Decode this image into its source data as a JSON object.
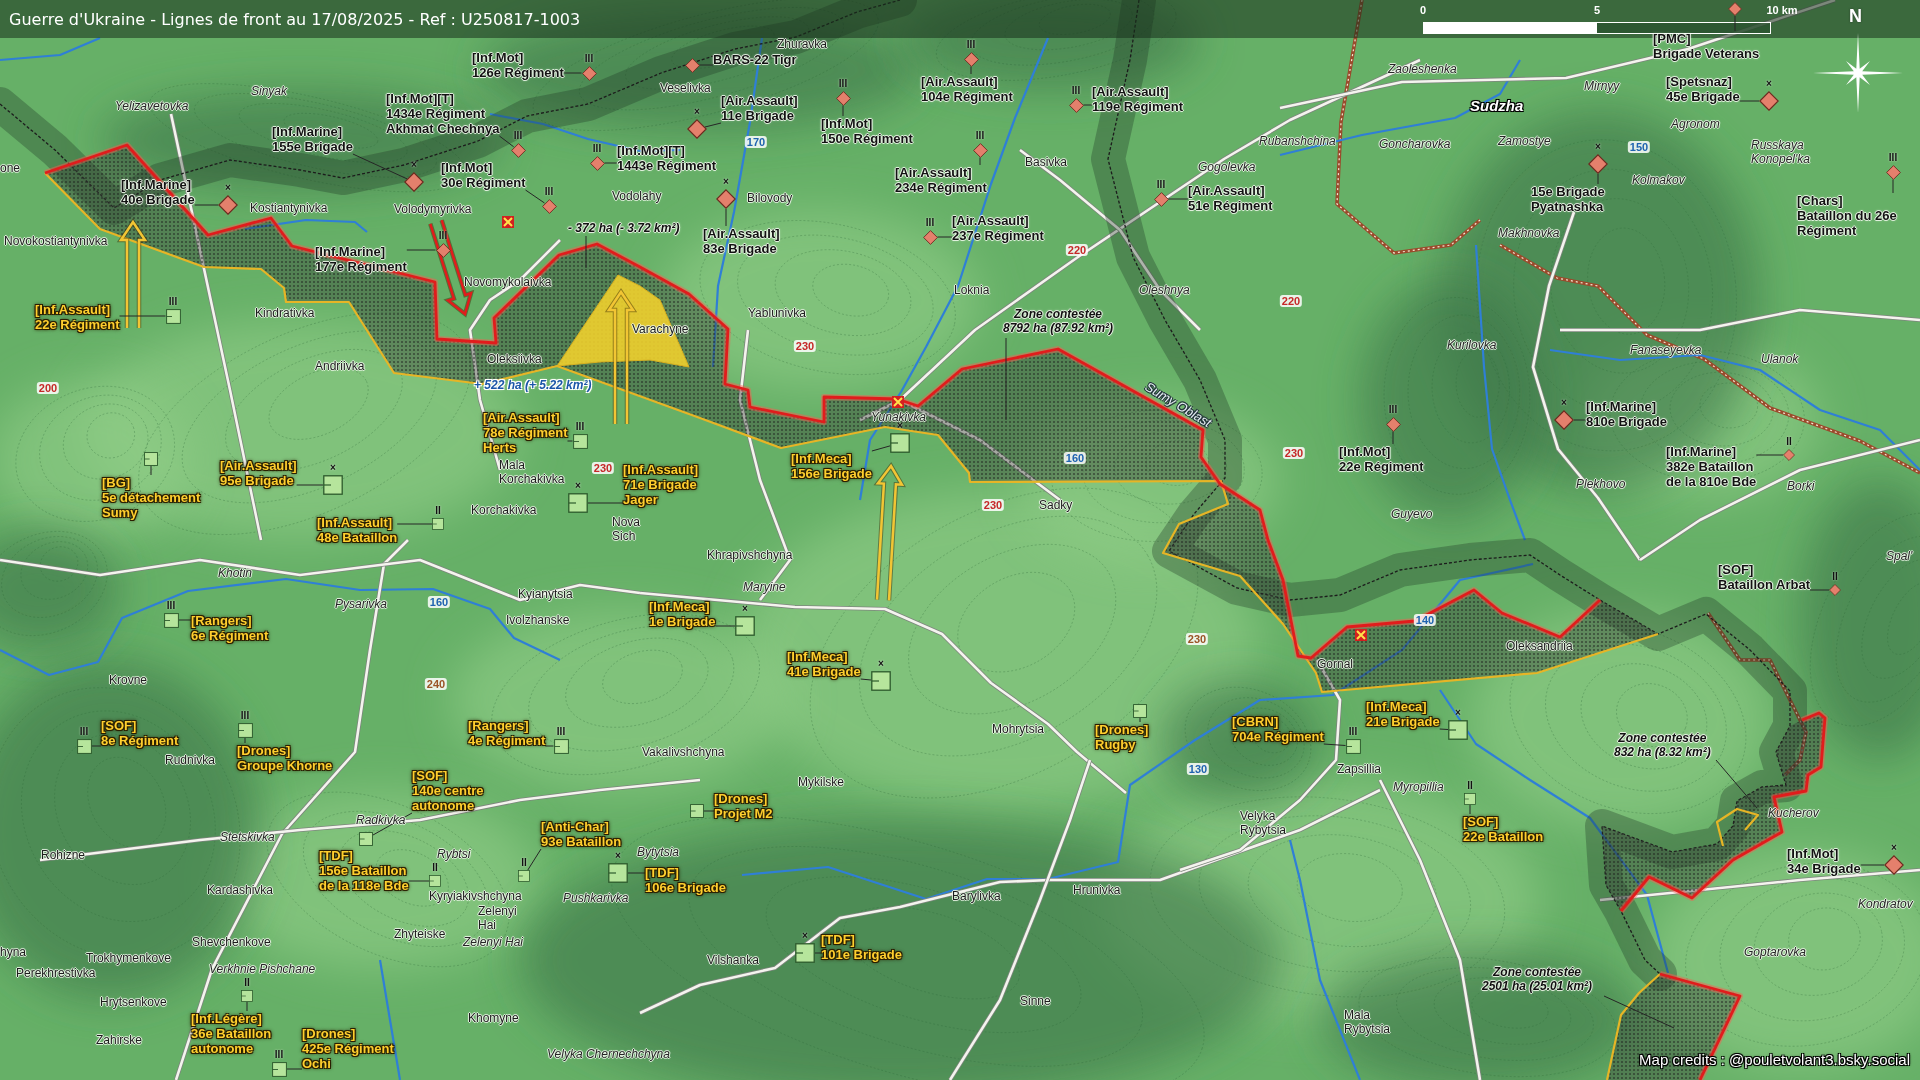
{
  "title": "Guerre d'Ukraine - Lignes de front au 17/08/2025 - Ref : U250817-1003",
  "scale_bar": {
    "ticks": [
      "0",
      "5",
      "10 km"
    ]
  },
  "compass": {
    "label": "N"
  },
  "units": [
    {
      "kind": "russian",
      "lines": [
        "[Inf.Mot]",
        "126e Régiment"
      ],
      "echelon": "III"
    },
    {
      "kind": "russian",
      "lines": [
        "BARS-22 Tigr"
      ]
    },
    {
      "kind": "russian",
      "lines": [
        "[Air.Assault]",
        "104e Régiment"
      ],
      "echelon": "III"
    },
    {
      "kind": "russian",
      "lines": [
        "[PMC]",
        "Brigade Veterans"
      ]
    },
    {
      "kind": "russian",
      "lines": [
        "[Inf.Mot][T]",
        "1434e Régiment",
        "Akhmat Chechnya"
      ],
      "echelon": "III"
    },
    {
      "kind": "russian",
      "lines": [
        "[Air.Assault]",
        "11e Brigade"
      ],
      "echelon": "×"
    },
    {
      "kind": "russian",
      "lines": [
        "[Inf.Mot]",
        "150e Régiment"
      ],
      "echelon": "III"
    },
    {
      "kind": "russian",
      "lines": [
        "[Air.Assault]",
        "119e Régiment"
      ],
      "echelon": "III"
    },
    {
      "kind": "russian",
      "lines": [
        "[Spetsnaz]",
        "45e Brigade"
      ],
      "echelon": "×"
    },
    {
      "kind": "russian",
      "lines": [
        "[Inf.Marine]",
        "40e Brigade"
      ],
      "echelon": "×"
    },
    {
      "kind": "russian",
      "lines": [
        "[Inf.Marine]",
        "155e Brigade"
      ],
      "echelon": "×"
    },
    {
      "kind": "russian",
      "lines": [
        "[Inf.Marine]",
        "177e Régiment"
      ],
      "echelon": "III"
    },
    {
      "kind": "russian",
      "lines": [
        "[Inf.Mot]",
        "30e Régiment"
      ],
      "echelon": "III"
    },
    {
      "kind": "russian",
      "lines": [
        "[Inf.Mot][T]",
        "1443e Régiment"
      ],
      "echelon": "III"
    },
    {
      "kind": "russian",
      "lines": [
        "[Air.Assault]",
        "83e Brigade"
      ],
      "echelon": "×"
    },
    {
      "kind": "russian",
      "lines": [
        "[Air.Assault]",
        "234e Régiment"
      ],
      "echelon": "III"
    },
    {
      "kind": "russian",
      "lines": [
        "[Air.Assault]",
        "237e Régiment"
      ],
      "echelon": "III"
    },
    {
      "kind": "russian",
      "lines": [
        "[Air.Assault]",
        "51e Régiment"
      ],
      "echelon": "III"
    },
    {
      "kind": "russian",
      "lines": [
        "15e Brigade",
        "Pyatnashka"
      ],
      "echelon": "×"
    },
    {
      "kind": "russian",
      "lines": [
        "[Chars]",
        "Bataillon du 26e",
        "Régiment"
      ],
      "echelon": "III"
    },
    {
      "kind": "ukrainian",
      "lines": [
        "[Inf.Assault]",
        "22e Régiment"
      ],
      "echelon": "III"
    },
    {
      "kind": "ukrainian",
      "lines": [
        "[Air.Assault]",
        "78e Régiment",
        "Herts"
      ],
      "echelon": "III"
    },
    {
      "kind": "ukrainian",
      "lines": [
        "[Inf.Meca]",
        "156e Brigade"
      ],
      "echelon": "×"
    },
    {
      "kind": "russian",
      "lines": [
        "[Inf.Mot]",
        "22e Régiment"
      ],
      "echelon": "III"
    },
    {
      "kind": "russian",
      "lines": [
        "[Inf.Marine]",
        "810e Brigade"
      ],
      "echelon": "×"
    },
    {
      "kind": "ukrainian",
      "lines": [
        "[BG]",
        "5e détachement",
        "Sumy"
      ]
    },
    {
      "kind": "ukrainian",
      "lines": [
        "[Air.Assault]",
        "95e Brigade"
      ],
      "echelon": "×"
    },
    {
      "kind": "ukrainian",
      "lines": [
        "[Inf.Assault]",
        "71e Brigade",
        "Jager"
      ],
      "echelon": "×"
    },
    {
      "kind": "russian",
      "lines": [
        "[Inf.Marine]",
        "382e Bataillon",
        "de la 810e Bde"
      ],
      "echelon": "II"
    },
    {
      "kind": "ukrainian",
      "lines": [
        "[Inf.Assault]",
        "48e Bataillon"
      ],
      "echelon": "II"
    },
    {
      "kind": "russian",
      "lines": [
        "[SOF]",
        "Bataillon Arbat"
      ],
      "echelon": "II"
    },
    {
      "kind": "ukrainian",
      "lines": [
        "[Rangers]",
        "6e Régiment"
      ],
      "echelon": "III"
    },
    {
      "kind": "ukrainian",
      "lines": [
        "[Inf.Meca]",
        "1e Brigade"
      ],
      "echelon": "×"
    },
    {
      "kind": "ukrainian",
      "lines": [
        "[Inf.Meca]",
        "41e Brigade"
      ],
      "echelon": "×"
    },
    {
      "kind": "ukrainian",
      "lines": [
        "[SOF]",
        "8e Régiment"
      ],
      "echelon": "III"
    },
    {
      "kind": "ukrainian",
      "lines": [
        "[Drones]",
        "Groupe Khorne"
      ],
      "echelon": "III"
    },
    {
      "kind": "ukrainian",
      "lines": [
        "[Rangers]",
        "4e Régiment"
      ],
      "echelon": "III"
    },
    {
      "kind": "ukrainian",
      "lines": [
        "[Drones]",
        "Rugby"
      ]
    },
    {
      "kind": "ukrainian",
      "lines": [
        "[CBRN]",
        "704e Régiment"
      ],
      "echelon": "III"
    },
    {
      "kind": "ukrainian",
      "lines": [
        "[Inf.Meca]",
        "21e Brigade"
      ],
      "echelon": "×"
    },
    {
      "kind": "ukrainian",
      "lines": [
        "[SOF]",
        "140e centre",
        "autonome"
      ]
    },
    {
      "kind": "ukrainian",
      "lines": [
        "[Drones]",
        "Projet M2"
      ]
    },
    {
      "kind": "ukrainian",
      "lines": [
        "[SOF]",
        "22e Bataillon"
      ],
      "echelon": "II"
    },
    {
      "kind": "ukrainian",
      "lines": [
        "[TDF]",
        "156e Bataillon",
        "de la 118e Bde"
      ],
      "echelon": "II"
    },
    {
      "kind": "ukrainian",
      "lines": [
        "[Anti-Char]",
        "93e Bataillon"
      ],
      "echelon": "II"
    },
    {
      "kind": "ukrainian",
      "lines": [
        "[TDF]",
        "106e Brigade"
      ],
      "echelon": "×"
    },
    {
      "kind": "russian",
      "lines": [
        "[Inf.Mot]",
        "34e Brigade"
      ],
      "echelon": "×"
    },
    {
      "kind": "ukrainian",
      "lines": [
        "[TDF]",
        "101e Brigade"
      ],
      "echelon": "×"
    },
    {
      "kind": "ukrainian",
      "lines": [
        "[Inf.Légère]",
        "36e Bataillon",
        "autonome"
      ],
      "echelon": "II"
    },
    {
      "kind": "ukrainian",
      "lines": [
        "[Drones]",
        "425e Régiment",
        "Ochi"
      ],
      "echelon": "III"
    }
  ],
  "places": [
    {
      "name": "Zhuravka",
      "kind": "village",
      "italic": false
    },
    {
      "name": "Zaoleshenka",
      "kind": "village",
      "italic": true
    },
    {
      "name": "Sinyak",
      "kind": "village",
      "italic": true
    },
    {
      "name": "Veselivka",
      "kind": "village",
      "italic": false
    },
    {
      "name": "Mirnyy",
      "kind": "village",
      "italic": true
    },
    {
      "name": "Yelizavetovka",
      "kind": "village",
      "italic": true
    },
    {
      "name": "Sudzha",
      "kind": "city",
      "italic": true
    },
    {
      "name": "Agronom",
      "kind": "village",
      "italic": true
    },
    {
      "name": "one",
      "kind": "village",
      "italic": false
    },
    {
      "name": "Basivka",
      "kind": "village",
      "italic": false
    },
    {
      "name": "Gogolevka",
      "kind": "village",
      "italic": true
    },
    {
      "name": "Rubanshchina",
      "kind": "village",
      "italic": true
    },
    {
      "name": "Goncharovka",
      "kind": "village",
      "italic": true
    },
    {
      "name": "Zamostye",
      "kind": "village",
      "italic": true
    },
    {
      "name": "Russkaya Konopel'ka",
      "kind": "village",
      "italic": true
    },
    {
      "name": "Kolmakov",
      "kind": "village",
      "italic": true
    },
    {
      "name": "Kostiantynivka",
      "kind": "village",
      "italic": false
    },
    {
      "name": "Volodymyrivka",
      "kind": "village",
      "italic": false
    },
    {
      "name": "Vodolahy",
      "kind": "village",
      "italic": false
    },
    {
      "name": "Bilovody",
      "kind": "village",
      "italic": false
    },
    {
      "name": "Novokostiantynivka",
      "kind": "village",
      "italic": false
    },
    {
      "name": "Makhnovka",
      "kind": "village",
      "italic": true
    },
    {
      "name": "Novomykolaivka",
      "kind": "village",
      "italic": false
    },
    {
      "name": "Loknia",
      "kind": "village",
      "italic": false
    },
    {
      "name": "Oleshnya",
      "kind": "village",
      "italic": true
    },
    {
      "name": "Kindrativka",
      "kind": "village",
      "italic": false
    },
    {
      "name": "Yablunivka",
      "kind": "village",
      "italic": false
    },
    {
      "name": "Varachyne",
      "kind": "village",
      "italic": false
    },
    {
      "name": "Kurilovka",
      "kind": "village",
      "italic": true
    },
    {
      "name": "Fanaseyevka",
      "kind": "village",
      "italic": true
    },
    {
      "name": "Andriivka",
      "kind": "village",
      "italic": false
    },
    {
      "name": "Oleksiivka",
      "kind": "village",
      "italic": false
    },
    {
      "name": "Ulanok",
      "kind": "village",
      "italic": true
    },
    {
      "name": "Yunakivka",
      "kind": "village",
      "italic": true
    },
    {
      "name": "Sumy Oblast",
      "kind": "region",
      "italic": true
    },
    {
      "name": "Mala Korchakivka",
      "kind": "village",
      "italic": false
    },
    {
      "name": "Plekhovo",
      "kind": "village",
      "italic": true
    },
    {
      "name": "Borki",
      "kind": "village",
      "italic": true
    },
    {
      "name": "Korchakivka",
      "kind": "village",
      "italic": false
    },
    {
      "name": "Nova Sich",
      "kind": "village",
      "italic": false
    },
    {
      "name": "Sadky",
      "kind": "village",
      "italic": false
    },
    {
      "name": "Guyevo",
      "kind": "village",
      "italic": true
    },
    {
      "name": "Khrapivshchyna",
      "kind": "village",
      "italic": false
    },
    {
      "name": "Spal'",
      "kind": "village",
      "italic": true
    },
    {
      "name": "Khotin",
      "kind": "village",
      "italic": true
    },
    {
      "name": "Kyianytsia",
      "kind": "village",
      "italic": false
    },
    {
      "name": "Maryine",
      "kind": "village",
      "italic": true
    },
    {
      "name": "Pysarivka",
      "kind": "village",
      "italic": true
    },
    {
      "name": "Ivolzhanske",
      "kind": "village",
      "italic": false
    },
    {
      "name": "Oleksandriia",
      "kind": "village",
      "italic": false
    },
    {
      "name": "Gornal",
      "kind": "village",
      "italic": false
    },
    {
      "name": "Krovne",
      "kind": "village",
      "italic": false
    },
    {
      "name": "Mohrytsia",
      "kind": "village",
      "italic": false
    },
    {
      "name": "Rudnivka",
      "kind": "village",
      "italic": false
    },
    {
      "name": "Vakalivshchyna",
      "kind": "village",
      "italic": false
    },
    {
      "name": "Mykilske",
      "kind": "village",
      "italic": false
    },
    {
      "name": "Zapsillia",
      "kind": "village",
      "italic": false
    },
    {
      "name": "Myropillia",
      "kind": "village",
      "italic": true
    },
    {
      "name": "Radkivka",
      "kind": "village",
      "italic": true
    },
    {
      "name": "Velyka Rybytsia",
      "kind": "village",
      "italic": false
    },
    {
      "name": "Kucherov",
      "kind": "village",
      "italic": true
    },
    {
      "name": "Stetskivka",
      "kind": "village",
      "italic": true
    },
    {
      "name": "Rohizne",
      "kind": "village",
      "italic": false
    },
    {
      "name": "Rybtsi",
      "kind": "village",
      "italic": true
    },
    {
      "name": "Bytytsia",
      "kind": "village",
      "italic": true
    },
    {
      "name": "Kardashivka",
      "kind": "village",
      "italic": false
    },
    {
      "name": "Kyryiakivshchyna",
      "kind": "village",
      "italic": false
    },
    {
      "name": "Pushkarivka",
      "kind": "village",
      "italic": true
    },
    {
      "name": "Barylivka",
      "kind": "village",
      "italic": false
    },
    {
      "name": "Hrunivka",
      "kind": "village",
      "italic": false
    },
    {
      "name": "Zelenyi Hai",
      "kind": "village",
      "italic": false
    },
    {
      "name": "Kondratov",
      "kind": "village",
      "italic": true
    },
    {
      "name": "hyna",
      "kind": "village",
      "italic": false
    },
    {
      "name": "Trokhymenkove",
      "kind": "village",
      "italic": false
    },
    {
      "name": "Shevchenkove",
      "kind": "village",
      "italic": false
    },
    {
      "name": "Zhyteiske",
      "kind": "village",
      "italic": false
    },
    {
      "name": "Zelenyi Hai",
      "kind": "village",
      "italic": true
    },
    {
      "name": "Vilshanka",
      "kind": "village",
      "italic": false
    },
    {
      "name": "Goptarovka",
      "kind": "village",
      "italic": true
    },
    {
      "name": "Perekhrestivka",
      "kind": "village",
      "italic": false
    },
    {
      "name": "Verkhnie Pishchane",
      "kind": "village",
      "italic": true
    },
    {
      "name": "Hrytsenkove",
      "kind": "village",
      "italic": false
    },
    {
      "name": "Sinne",
      "kind": "village",
      "italic": false
    },
    {
      "name": "Zahirske",
      "kind": "village",
      "italic": false
    },
    {
      "name": "Khomyne",
      "kind": "village",
      "italic": false
    },
    {
      "name": "Mala Rybytsia",
      "kind": "village",
      "italic": false
    },
    {
      "name": "Velyka Chernechchyna",
      "kind": "village",
      "italic": true
    }
  ],
  "road_numbers": [
    {
      "label": "170",
      "color": "#1f63b0"
    },
    {
      "label": "150",
      "color": "#1f63b0"
    },
    {
      "label": "220",
      "color": "#c62828"
    },
    {
      "label": "220",
      "color": "#c62828"
    },
    {
      "label": "230",
      "color": "#c62828"
    },
    {
      "label": "200",
      "color": "#c62828"
    },
    {
      "label": "160",
      "color": "#1f63b0"
    },
    {
      "label": "230",
      "color": "#c62828"
    },
    {
      "label": "230",
      "color": "#c62828"
    },
    {
      "label": "230",
      "color": "#c62828"
    },
    {
      "label": "160",
      "color": "#1f63b0"
    },
    {
      "label": "140",
      "color": "#1f63b0"
    },
    {
      "label": "230",
      "color": "#9a5326"
    },
    {
      "label": "240",
      "color": "#9a5326"
    },
    {
      "label": "130",
      "color": "#1f63b0"
    }
  ],
  "area_labels": [
    {
      "kind": "loss",
      "lines": [
        "- 372 ha (- 3.72 km²)"
      ]
    },
    {
      "kind": "contested",
      "lines": [
        "Zone contestée",
        "8792 ha (87.92 km²)"
      ]
    },
    {
      "kind": "gain",
      "lines": [
        "+ 522 ha (+ 5.22 km²)"
      ]
    },
    {
      "kind": "contested",
      "lines": [
        "Zone contestée",
        "832 ha (8.32 km²)"
      ]
    },
    {
      "kind": "contested",
      "lines": [
        "Zone contestée",
        "2501 ha (25.01 km²)"
      ]
    }
  ],
  "credits": "Map credits : @pouletvolant3.bsky.social"
}
